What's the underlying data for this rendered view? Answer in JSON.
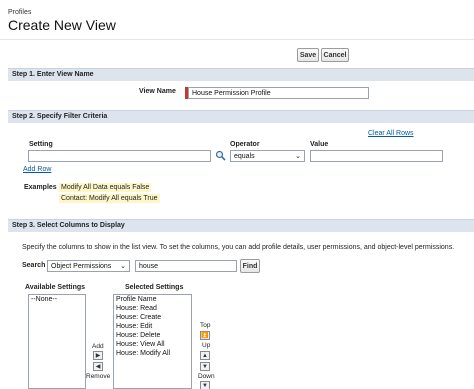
{
  "header": {
    "breadcrumb": "Profiles",
    "title": "Create New View"
  },
  "toolbar": {
    "save_label": "Save",
    "cancel_label": "Cancel"
  },
  "step1": {
    "title": "Step 1. Enter View Name",
    "view_name_label": "View Name",
    "view_name_value": "House Permission Profile"
  },
  "step2": {
    "title": "Step 2. Specify Filter Criteria",
    "clear_all_rows": "Clear All Rows",
    "setting_label": "Setting",
    "operator_label": "Operator",
    "value_label": "Value",
    "operator_value": "equals",
    "add_row": "Add Row",
    "examples_label": "Examples",
    "example_1": "Modify All Data equals False",
    "example_2": "Contact: Modify All equals True"
  },
  "step3": {
    "title": "Step 3. Select Columns to Display",
    "description": "Specify the columns to show in the list view. To set the columns, you can add profile details, user permissions, and object-level permissions.",
    "search_label": "Search",
    "search_scope": "Object Permissions",
    "search_value": "house",
    "find_label": "Find",
    "available_label": "Available Settings",
    "selected_label": "Selected Settings",
    "available_options": [
      "--None--"
    ],
    "selected_options": [
      "Profile Name",
      "House: Read",
      "House: Create",
      "House: Edit",
      "House: Delete",
      "House: View All",
      "House: Modify All"
    ],
    "add_label": "Add",
    "remove_label": "Remove",
    "top_label": "Top",
    "up_label": "Up",
    "down_label": "Down"
  }
}
